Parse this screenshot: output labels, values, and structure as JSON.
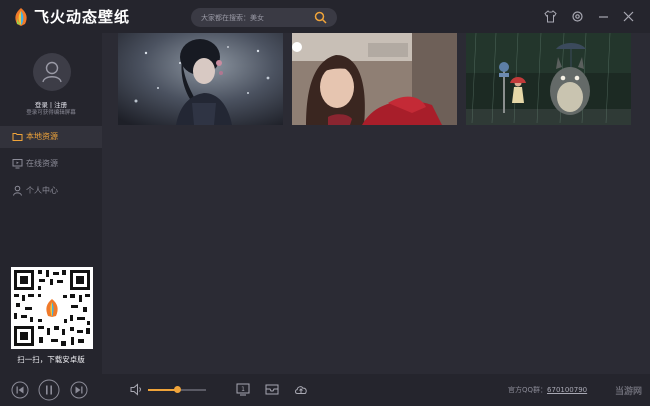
{
  "app": {
    "title": "飞火动态壁纸"
  },
  "search": {
    "placeholder": "大家都在搜索：美女"
  },
  "window_controls": [
    "skin-icon",
    "settings-icon",
    "minimize-icon",
    "close-icon"
  ],
  "sidebar": {
    "login_label": "登录 | 注册",
    "login_hint": "登录可获得编辑屏幕",
    "nav": [
      {
        "label": "本地资源",
        "icon": "folder-icon",
        "active": true
      },
      {
        "label": "在线资源",
        "icon": "monitor-icon",
        "active": false
      },
      {
        "label": "个人中心",
        "icon": "user-icon",
        "active": false
      }
    ],
    "qr_caption": "扫一扫，下载安卓版"
  },
  "wallpapers": [
    {
      "name": "anime-girl-wallpaper"
    },
    {
      "name": "woman-photo-wallpaper"
    },
    {
      "name": "totoro-rain-wallpaper"
    }
  ],
  "player": {
    "volume_percent": 50
  },
  "footer": {
    "qq_label": "官方QQ群：",
    "qq_number": "670100790",
    "watermark": "当游网"
  },
  "colors": {
    "accent": "#f0a43a",
    "background": "#2b2b34",
    "panel": "#25252d"
  }
}
